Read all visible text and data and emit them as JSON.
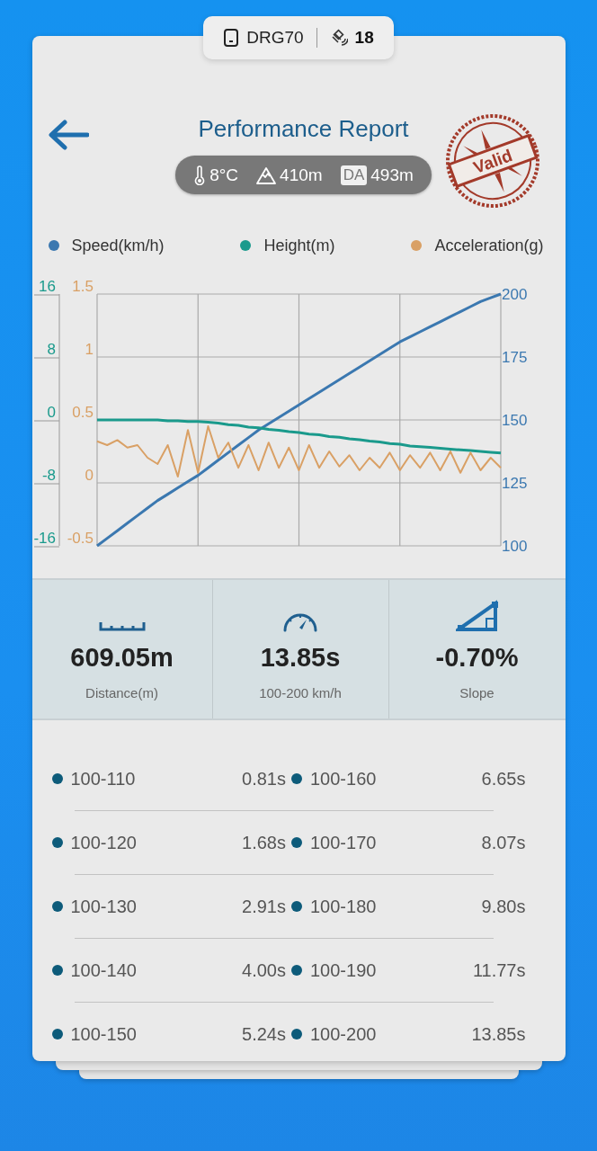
{
  "status_chip": {
    "device": "DRG70",
    "satellites": "18"
  },
  "header": {
    "title": "Performance Report",
    "stamp": "Valid",
    "conditions": [
      {
        "kind": "temperature",
        "value": "8°C"
      },
      {
        "kind": "altitude",
        "value": "410m"
      },
      {
        "kind": "density_altitude",
        "badge": "DA",
        "value": "493m"
      }
    ]
  },
  "charts": [
    {
      "chart_data": {
        "type": "line",
        "grid": true,
        "ylim": [
          100,
          200
        ],
        "yticks": [
          200,
          175,
          150,
          125,
          100
        ],
        "series": [
          {
            "name": "Speed(km/h)",
            "color": "#3b78b0",
            "values": [
              100,
              103,
              106,
              109,
              112,
              115,
              118,
              120.5,
              123,
              125.5,
              128,
              131,
              134,
              137,
              140,
              143,
              146,
              148.5,
              151,
              153.5,
              156,
              158.5,
              161,
              163.5,
              166,
              168.5,
              171,
              173.5,
              176,
              178.5,
              181,
              183,
              185,
              187,
              189,
              191,
              193,
              195,
              197,
              198.5,
              200
            ]
          }
        ]
      }
    },
    {
      "chart_data": {
        "type": "line",
        "ylim": [
          -16,
          16
        ],
        "yticks": [
          16,
          8,
          0,
          -8,
          -16
        ],
        "series": [
          {
            "name": "Height(m)",
            "color": "#1a9a8c",
            "values": [
              0,
              0,
              0,
              0,
              0,
              0,
              0,
              -0.1,
              -0.1,
              -0.2,
              -0.2,
              -0.3,
              -0.4,
              -0.6,
              -0.7,
              -0.9,
              -1,
              -1.2,
              -1.3,
              -1.5,
              -1.6,
              -1.8,
              -1.9,
              -2.1,
              -2.2,
              -2.4,
              -2.5,
              -2.7,
              -2.8,
              -3,
              -3.1,
              -3.3,
              -3.4,
              -3.5,
              -3.6,
              -3.7,
              -3.8,
              -3.9,
              -4,
              -4.1,
              -4.2
            ]
          }
        ]
      }
    },
    {
      "chart_data": {
        "type": "line",
        "ylim": [
          -0.5,
          1.5
        ],
        "yticks": [
          1.5,
          1,
          0.5,
          0,
          -0.5
        ],
        "series": [
          {
            "name": "Acceleration(g)",
            "color": "#d9a065",
            "values": [
              0.33,
              0.3,
              0.34,
              0.28,
              0.3,
              0.2,
              0.15,
              0.3,
              0.05,
              0.42,
              0.08,
              0.45,
              0.2,
              0.32,
              0.12,
              0.3,
              0.1,
              0.32,
              0.12,
              0.28,
              0.1,
              0.3,
              0.12,
              0.25,
              0.13,
              0.22,
              0.1,
              0.2,
              0.12,
              0.24,
              0.1,
              0.22,
              0.12,
              0.24,
              0.1,
              0.25,
              0.08,
              0.24,
              0.1,
              0.2,
              0.12
            ]
          }
        ]
      }
    }
  ],
  "stats": [
    {
      "kind": "distance",
      "value": "609.05m",
      "label": "Distance(m)"
    },
    {
      "kind": "time",
      "value": "13.85s",
      "label": "100-200 km/h"
    },
    {
      "kind": "slope",
      "value": "-0.70%",
      "label": "Slope"
    }
  ],
  "splits": [
    [
      {
        "range": "100-110",
        "time": "0.81s"
      },
      {
        "range": "100-160",
        "time": "6.65s"
      }
    ],
    [
      {
        "range": "100-120",
        "time": "1.68s"
      },
      {
        "range": "100-170",
        "time": "8.07s"
      }
    ],
    [
      {
        "range": "100-130",
        "time": "2.91s"
      },
      {
        "range": "100-180",
        "time": "9.80s"
      }
    ],
    [
      {
        "range": "100-140",
        "time": "4.00s"
      },
      {
        "range": "100-190",
        "time": "11.77s"
      }
    ],
    [
      {
        "range": "100-150",
        "time": "5.24s"
      },
      {
        "range": "100-200",
        "time": "13.85s"
      }
    ]
  ]
}
